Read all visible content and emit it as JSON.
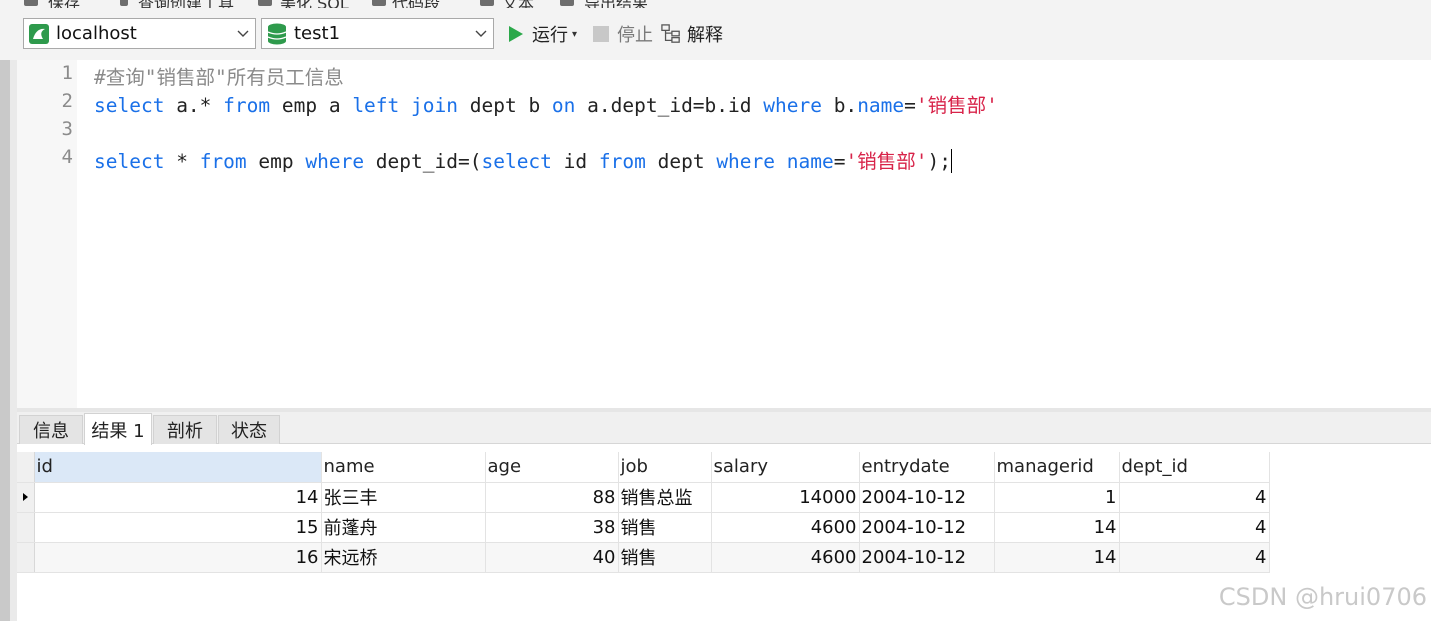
{
  "top_toolbar": {
    "items": [
      "保存",
      "查询创建工具",
      "美化 SQL",
      "代码段",
      "文本",
      "导出结果"
    ]
  },
  "connection_bar": {
    "connection": "localhost",
    "database": "test1",
    "run_label": "运行",
    "stop_label": "停止",
    "explain_label": "解释"
  },
  "editor": {
    "line_numbers": [
      "1",
      "2",
      "3",
      "4"
    ],
    "line1": {
      "comment": "#查询\"销售部\"所有员工信息"
    },
    "line2": {
      "t1": "select",
      "t2": " a.* ",
      "t3": "from",
      "t4": " emp a ",
      "t5": "left",
      "t6": " ",
      "t7": "join",
      "t8": " dept b ",
      "t9": "on",
      "t10": " a.dept_id=b.id ",
      "t11": "where",
      "t12": " b.",
      "t13": "name",
      "t14": "=",
      "t15": "'销售部'"
    },
    "line4": {
      "t1": "select",
      "t2": " * ",
      "t3": "from",
      "t4": " emp ",
      "t5": "where",
      "t6": " dept_id=(",
      "t7": "select",
      "t8": " id ",
      "t9": "from",
      "t10": " dept ",
      "t11": "where",
      "t12": " ",
      "t13": "name",
      "t14": "=",
      "t15": "'销售部'",
      "t16": ");"
    }
  },
  "result_tabs": [
    "信息",
    "结果 1",
    "剖析",
    "状态"
  ],
  "results": {
    "columns": [
      "id",
      "name",
      "age",
      "job",
      "salary",
      "entrydate",
      "managerid",
      "dept_id"
    ],
    "rows": [
      [
        "14",
        "张三丰",
        "88",
        "销售总监",
        "14000",
        "2004-10-12",
        "1",
        "4"
      ],
      [
        "15",
        "前蓬舟",
        "38",
        "销售",
        "4600",
        "2004-10-12",
        "14",
        "4"
      ],
      [
        "16",
        "宋远桥",
        "40",
        "销售",
        "4600",
        "2004-10-12",
        "14",
        "4"
      ]
    ]
  },
  "watermark": "CSDN @hrui0706",
  "colors": {
    "keyword": "#1a70e8",
    "string": "#d8244a",
    "comment": "#8a8a8a",
    "run_green": "#2ba84a"
  }
}
